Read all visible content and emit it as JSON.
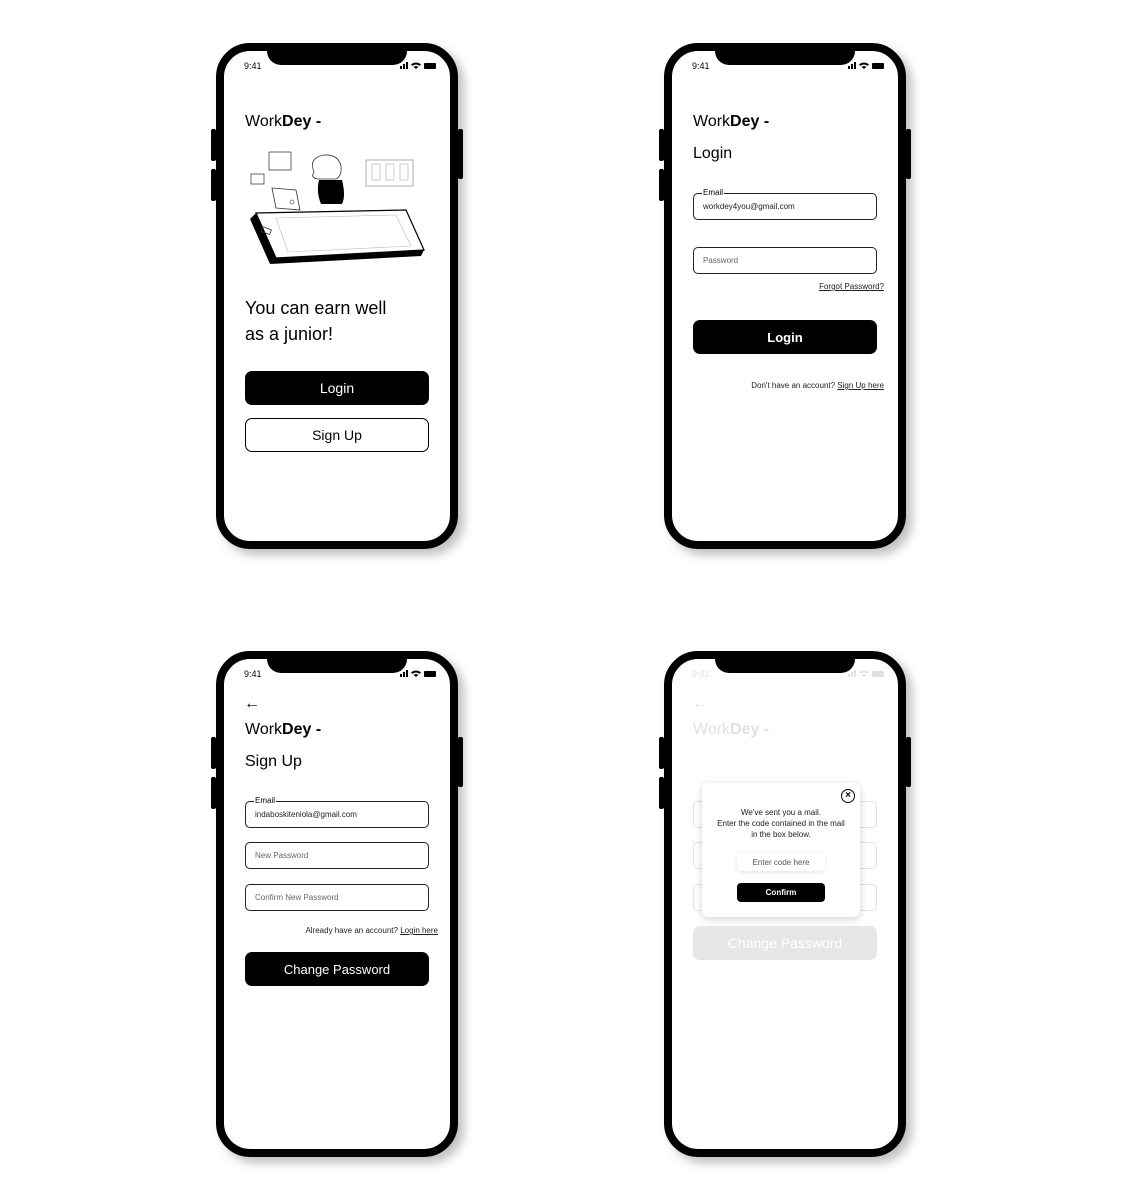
{
  "status_bar": {
    "time": "9:41"
  },
  "brand": {
    "regular": "Work",
    "bold": "Dey -"
  },
  "welcome": {
    "illustration": "woman-at-laptop-illustration",
    "headline_line1": "You can earn well",
    "headline_line2": "as a junior!",
    "login_label": "Login",
    "signup_label": "Sign Up"
  },
  "login": {
    "title": "Login",
    "email_legend": "Email",
    "email_value": "workdey4you@gmail.com",
    "password_placeholder": "Password",
    "forgot_label": "Forgot Password?",
    "login_label": "Login",
    "no_account_text": "Don't have an account?",
    "signup_link": "Sign Up here"
  },
  "signup": {
    "back_icon": "arrow-left-icon",
    "title": "Sign Up",
    "email_legend": "Email",
    "email_value": "indaboskiteniola@gmail.com",
    "new_password_placeholder": "New Password",
    "confirm_password_placeholder": "Confirm New Password",
    "have_account_text": "Already have an account?",
    "login_link": "Login here",
    "change_password_label": "Change Password"
  },
  "verify_modal": {
    "line1": "We've sent you a mail.",
    "line2": "Enter the code contained in the mail",
    "line3": "in the box below.",
    "code_placeholder": "Enter code here",
    "confirm_label": "Confirm",
    "close_icon": "close-circle-icon",
    "background_button_label": "Change Password"
  }
}
